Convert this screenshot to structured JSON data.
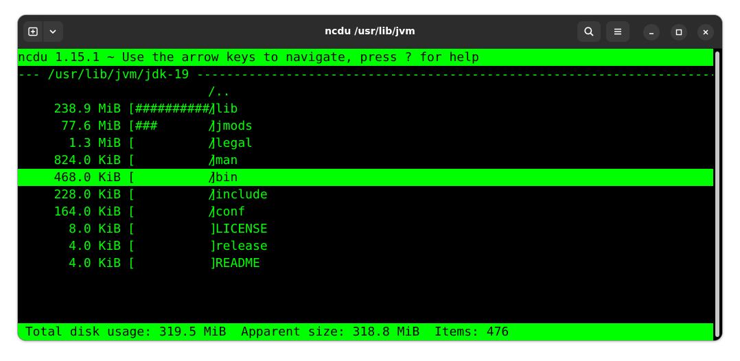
{
  "window": {
    "title": "ncdu /usr/lib/jvm"
  },
  "icons": {
    "new_tab": "new-tab-icon",
    "dropdown": "chevron-down-icon",
    "search": "search-icon",
    "menu": "hamburger-menu-icon",
    "minimize": "minimize-icon",
    "maximize": "maximize-icon",
    "close": "close-icon"
  },
  "colors": {
    "terminal_fg": "#00ff00",
    "terminal_bg": "#000000",
    "titlebar_bg": "#2c2c2c"
  },
  "ncdu": {
    "header": "ncdu 1.15.1 ~ Use the arrow keys to navigate, press ? for help",
    "path_line": "--- /usr/lib/jvm/jdk-19 -------------------------------------------------------------------------------",
    "parent_entry": "/..",
    "entries": [
      {
        "size": "238.9 MiB",
        "bar": "[##########]",
        "name": "/lib",
        "selected": false
      },
      {
        "size": "77.6 MiB",
        "bar": "[###       ]",
        "name": "/jmods",
        "selected": false
      },
      {
        "size": "1.3 MiB",
        "bar": "[          ]",
        "name": "/legal",
        "selected": false
      },
      {
        "size": "824.0 KiB",
        "bar": "[          ]",
        "name": "/man",
        "selected": false
      },
      {
        "size": "468.0 KiB",
        "bar": "[          ]",
        "name": "/bin",
        "selected": true
      },
      {
        "size": "228.0 KiB",
        "bar": "[          ]",
        "name": "/include",
        "selected": false
      },
      {
        "size": "164.0 KiB",
        "bar": "[          ]",
        "name": "/conf",
        "selected": false
      },
      {
        "size": "8.0 KiB",
        "bar": "[          ]",
        "name": " LICENSE",
        "selected": false
      },
      {
        "size": "4.0 KiB",
        "bar": "[          ]",
        "name": " release",
        "selected": false
      },
      {
        "size": "4.0 KiB",
        "bar": "[          ]",
        "name": " README",
        "selected": false
      }
    ],
    "footer": " Total disk usage: 319.5 MiB  Apparent size: 318.8 MiB  Items: 476"
  }
}
